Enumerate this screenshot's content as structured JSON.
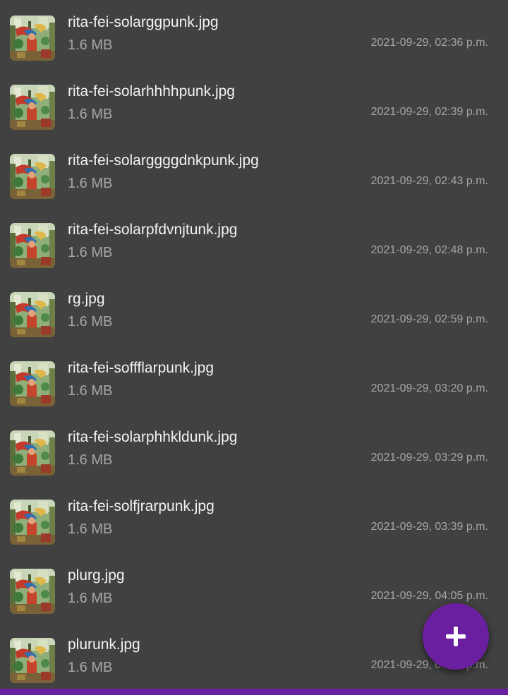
{
  "files": [
    {
      "name": "rita-fei-solarggpunk.jpg",
      "size": "1.6 MB",
      "date": "2021-09-29, 02:36 p.m.",
      "icon": "image-thumbnail-icon"
    },
    {
      "name": "rita-fei-solarhhhhpunk.jpg",
      "size": "1.6 MB",
      "date": "2021-09-29, 02:39 p.m.",
      "icon": "image-thumbnail-icon"
    },
    {
      "name": "rita-fei-solarggggdnkpunk.jpg",
      "size": "1.6 MB",
      "date": "2021-09-29, 02:43 p.m.",
      "icon": "image-thumbnail-icon"
    },
    {
      "name": "rita-fei-solarpfdvnjtunk.jpg",
      "size": "1.6 MB",
      "date": "2021-09-29, 02:48 p.m.",
      "icon": "image-thumbnail-icon"
    },
    {
      "name": "rg.jpg",
      "size": "1.6 MB",
      "date": "2021-09-29, 02:59 p.m.",
      "icon": "image-thumbnail-icon"
    },
    {
      "name": "rita-fei-soffflarpunk.jpg",
      "size": "1.6 MB",
      "date": "2021-09-29, 03:20 p.m.",
      "icon": "image-thumbnail-icon"
    },
    {
      "name": "rita-fei-solarphhkldunk.jpg",
      "size": "1.6 MB",
      "date": "2021-09-29, 03:29 p.m.",
      "icon": "image-thumbnail-icon"
    },
    {
      "name": "rita-fei-solfjrarpunk.jpg",
      "size": "1.6 MB",
      "date": "2021-09-29, 03:39 p.m.",
      "icon": "image-thumbnail-icon"
    },
    {
      "name": "plurg.jpg",
      "size": "1.6 MB",
      "date": "2021-09-29, 04:05 p.m.",
      "icon": "image-thumbnail-icon"
    },
    {
      "name": "plurunk.jpg",
      "size": "1.6 MB",
      "date": "2021-09-29, 04:22 p.m.",
      "icon": "image-thumbnail-icon"
    }
  ],
  "fab": {
    "icon": "plus-icon"
  },
  "colors": {
    "background": "#414141",
    "accent": "#6a1fa0",
    "primary_text": "#f2f2f2",
    "secondary_text": "#a6a6a6"
  }
}
